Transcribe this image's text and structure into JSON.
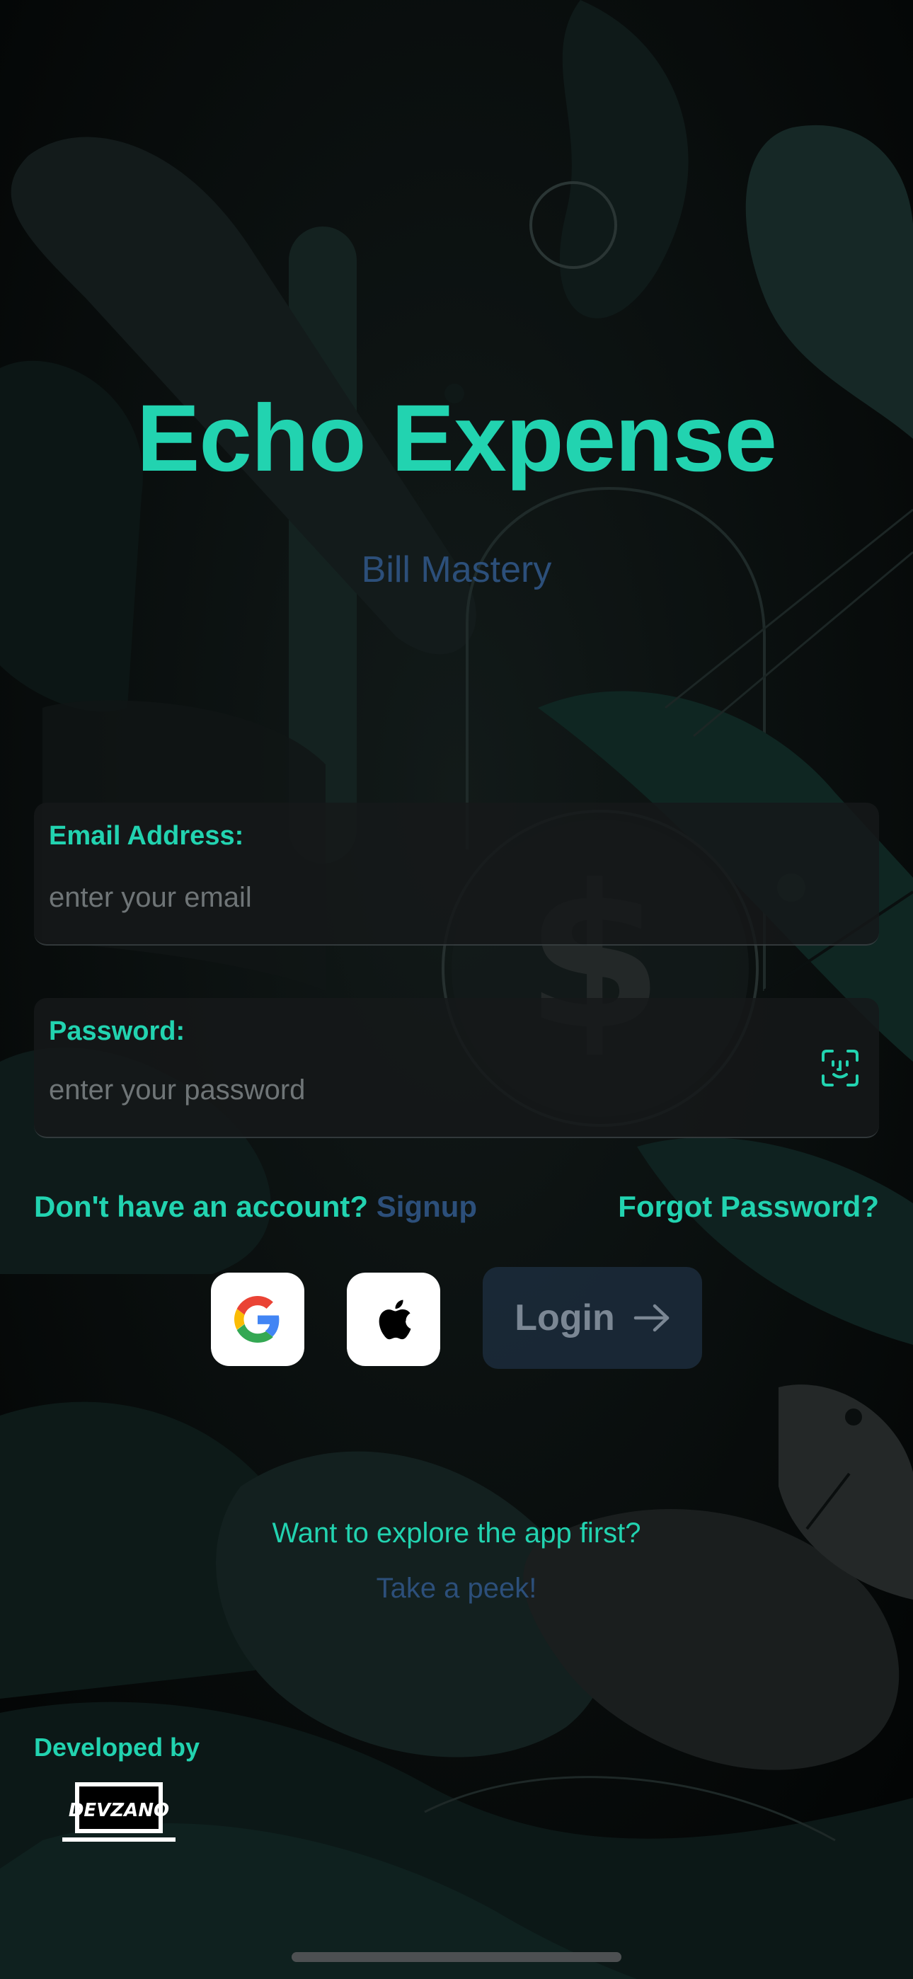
{
  "app": {
    "title": "Echo Expense",
    "subtitle": "Bill Mastery"
  },
  "form": {
    "email_label": "Email Address:",
    "email_placeholder": "enter your email",
    "email_value": "",
    "password_label": "Password:",
    "password_placeholder": "enter your password",
    "password_value": ""
  },
  "links": {
    "signup_prompt": "Don't have an account?",
    "signup": "Signup",
    "forgot_password": "Forgot Password?"
  },
  "actions": {
    "login": "Login",
    "social": [
      "google-icon",
      "apple-icon"
    ]
  },
  "explore": {
    "question": "Want to explore the app first?",
    "link": "Take a peek!"
  },
  "footer": {
    "developed_by": "Developed by",
    "developer_logo_text": "DEVZANO"
  },
  "colors": {
    "accent": "#22d3b0",
    "secondary": "#2c4f7a",
    "background": "#050707"
  },
  "icons": [
    "faceid-icon",
    "arrow-right-icon",
    "dollar-coin-icon"
  ]
}
